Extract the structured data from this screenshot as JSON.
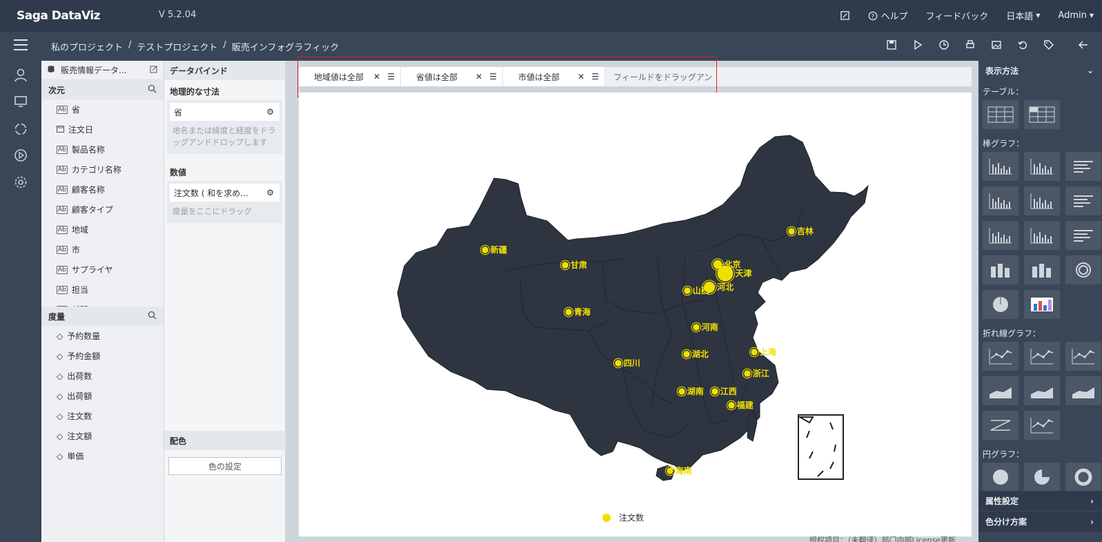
{
  "app": {
    "logo": "Saga DataViz",
    "version": "V 5.2.04"
  },
  "topmenu": {
    "help": "ヘルプ",
    "feedback": "フィードバック",
    "language": "日本語",
    "user": "Admin"
  },
  "breadcrumb": [
    "私のプロジェクト",
    "/",
    "テストプロジェクト",
    "/",
    "販売インフォグラフィック"
  ],
  "datasource": {
    "name": "販売情報データ..."
  },
  "dimensions": {
    "title": "次元",
    "items": [
      "省",
      "注文日",
      "製品名称",
      "カテゴリ名称",
      "顧客名称",
      "顧客タイプ",
      "地域",
      "市",
      "サプライヤ",
      "担当",
      "部門"
    ]
  },
  "measures": {
    "title": "度量",
    "items": [
      "予約数量",
      "予約金額",
      "出荷数",
      "出荷額",
      "注文数",
      "注文額",
      "単価"
    ]
  },
  "binding": {
    "title": "データバインド",
    "geo_title": "地理的な寸法",
    "geo_field": "省",
    "geo_hint": "地名または緯度と経度をドラッグアンドドロップします",
    "value_title": "数値",
    "value_field": "注文数 ( 和を求め...",
    "value_hint": "度量をここにドラッグ",
    "color_title": "配色",
    "color_button": "色の設定"
  },
  "filters": {
    "chips": [
      "地域値は全部",
      "省値は全部",
      "市値は全部"
    ],
    "drop_hint": "フィールドをドラッグアン"
  },
  "chart_data": {
    "type": "scatter",
    "title": "",
    "legend": {
      "position": "bottom-center",
      "entries": [
        "注文数"
      ]
    },
    "marker_color": "#f0e000",
    "map_fill": "#2e3440",
    "points": [
      {
        "name": "新疆",
        "value": 1
      },
      {
        "name": "甘肃",
        "value": 1
      },
      {
        "name": "青海",
        "value": 1
      },
      {
        "name": "四川",
        "value": 1
      },
      {
        "name": "吉林",
        "value": 1
      },
      {
        "name": "北京",
        "value": 2
      },
      {
        "name": "天津",
        "value": 5
      },
      {
        "name": "河北",
        "value": 3
      },
      {
        "name": "山西",
        "value": 1
      },
      {
        "name": "河南",
        "value": 1
      },
      {
        "name": "湖北",
        "value": 1
      },
      {
        "name": "上海",
        "value": 1
      },
      {
        "name": "浙江",
        "value": 1
      },
      {
        "name": "湖南",
        "value": 1
      },
      {
        "name": "江西",
        "value": 1
      },
      {
        "name": "福建",
        "value": 1
      },
      {
        "name": "海南",
        "value": 1
      }
    ]
  },
  "footnote": "授权项目：（未翻译）部门内部License更新",
  "rightpanel": {
    "title": "表示方法",
    "groups": [
      "テーブル：",
      "棒グラフ：",
      "折れ線グラフ：",
      "円グラフ："
    ],
    "prop_settings": "属性設定",
    "color_scheme": "色分け方案"
  }
}
